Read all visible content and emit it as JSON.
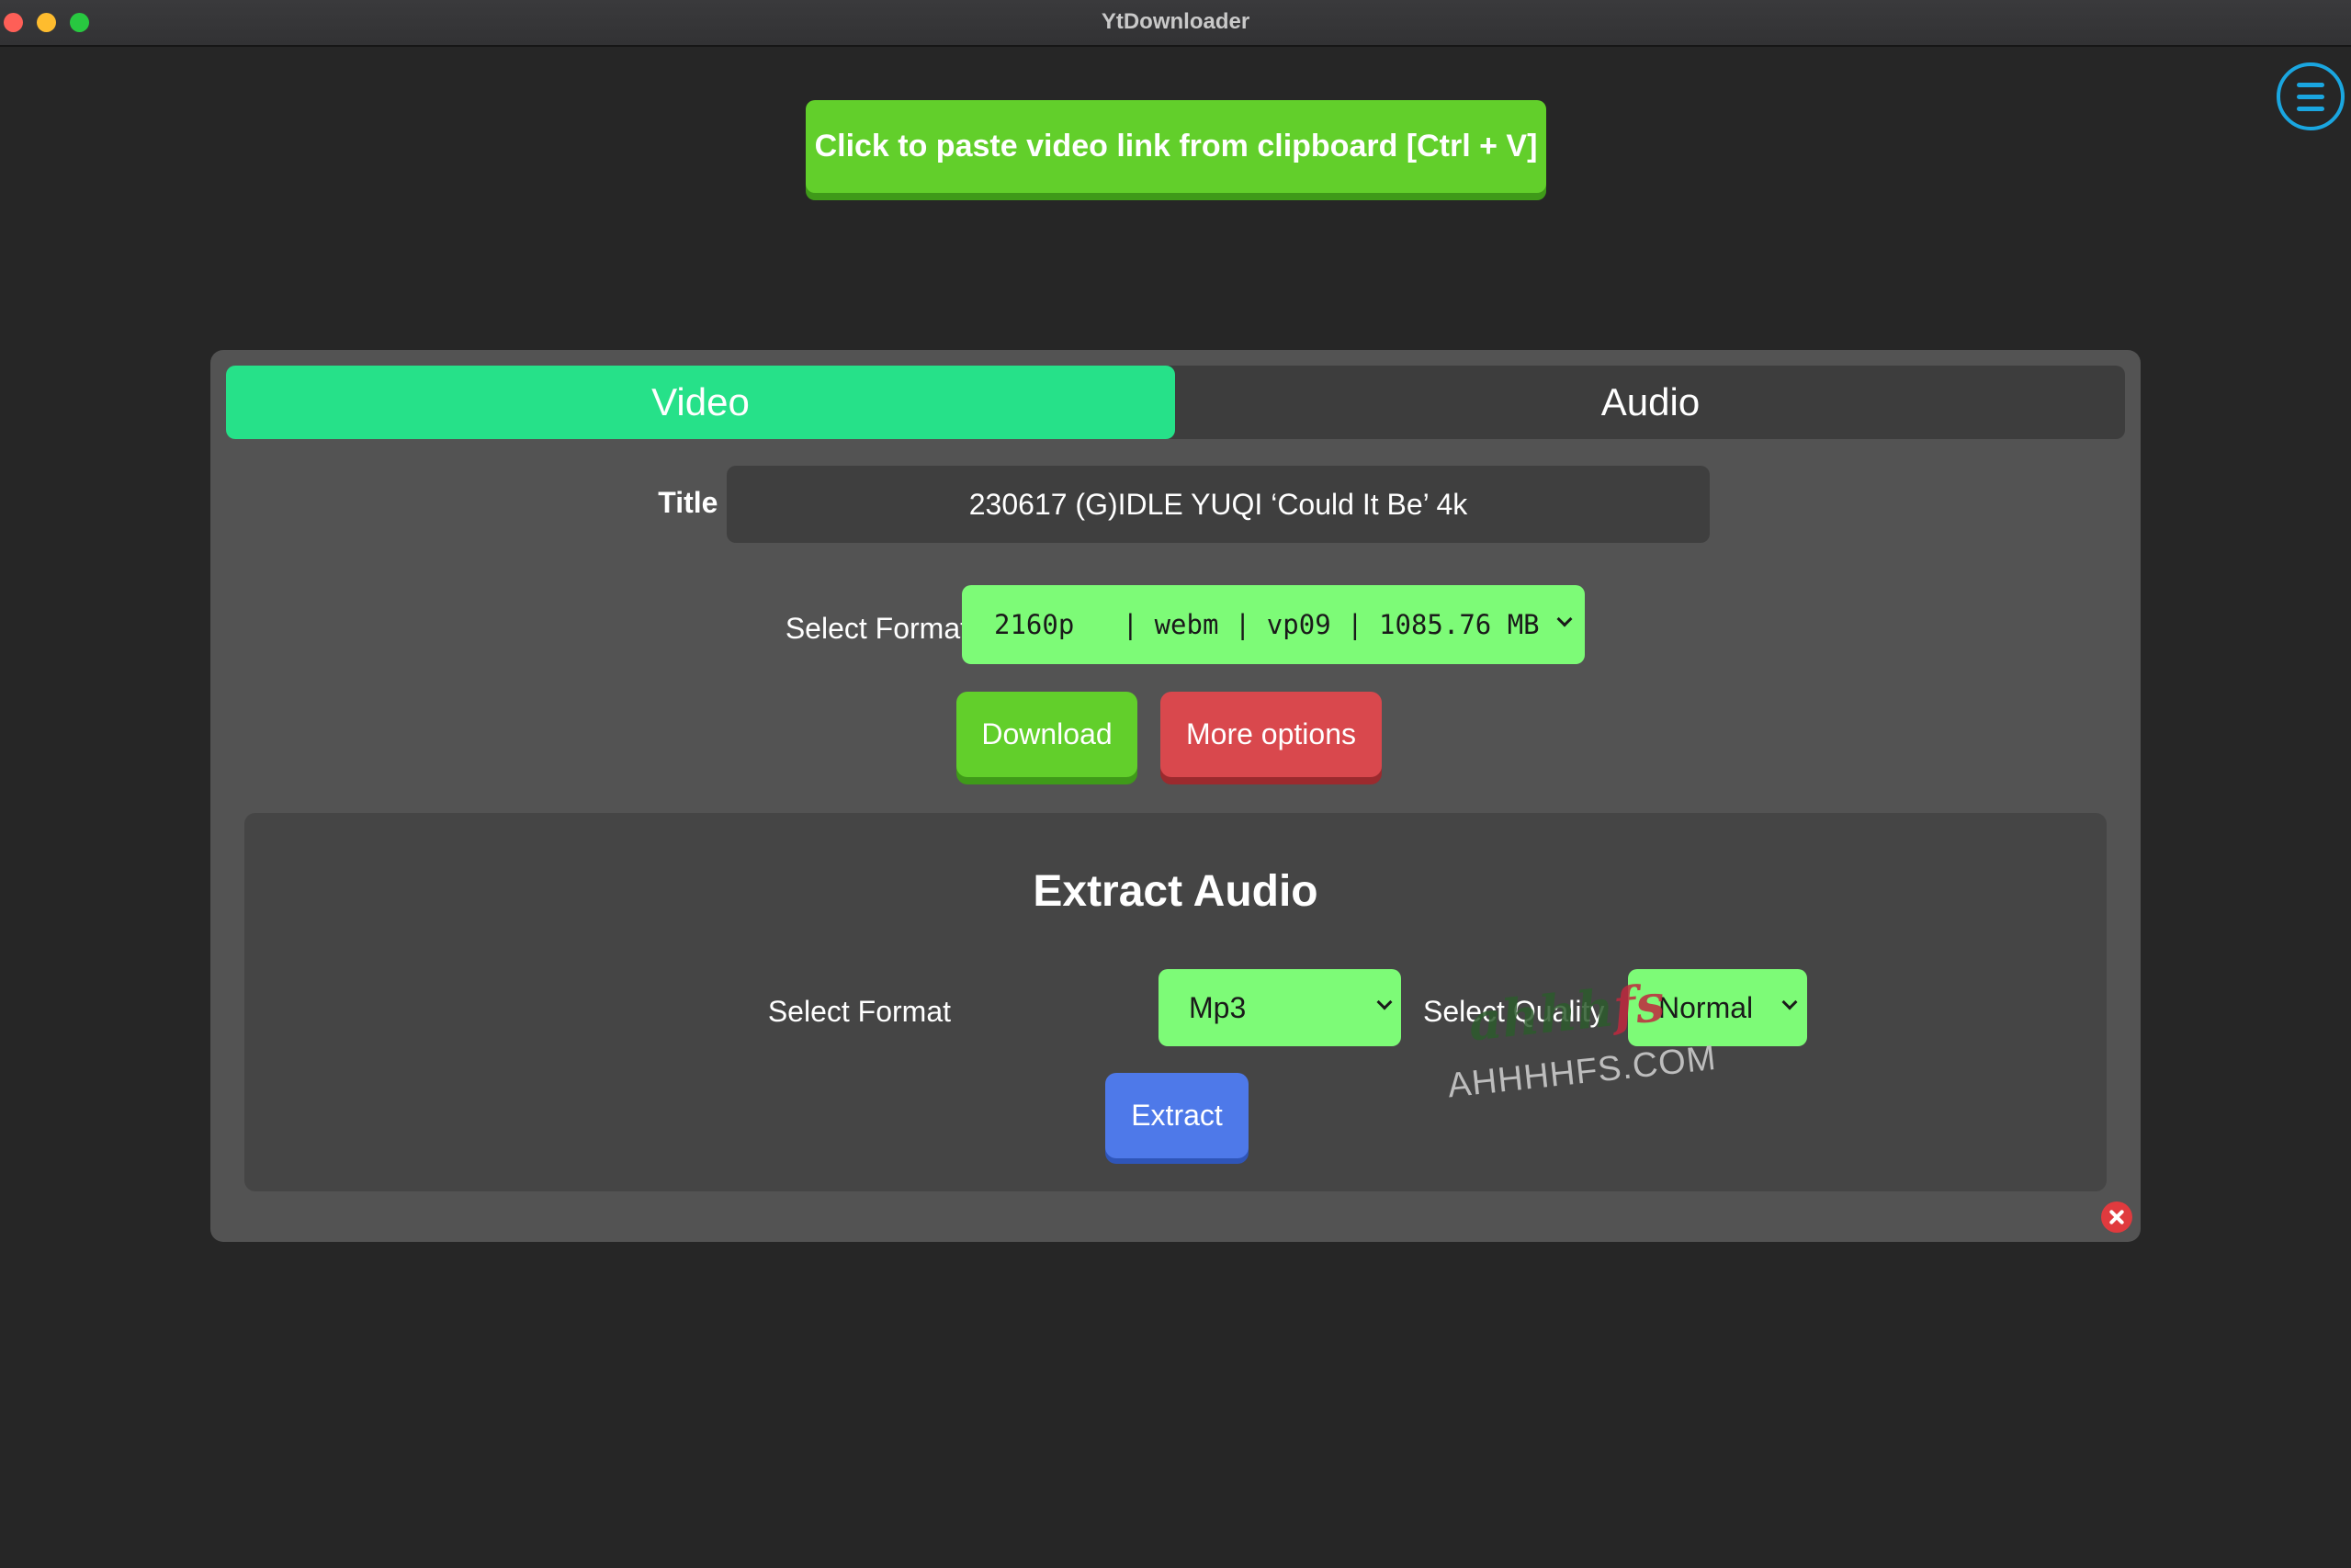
{
  "window": {
    "title": "YtDownloader"
  },
  "header": {
    "paste_label": "Click to paste video link from clipboard [Ctrl + V]",
    "menu_icon": "hamburger-menu-icon"
  },
  "tabs": [
    {
      "label": "Video",
      "active": true
    },
    {
      "label": "Audio",
      "active": false
    }
  ],
  "video": {
    "title_label": "Title :",
    "title_value": "230617 (G)IDLE YUQI ‘Could It Be’ 4k",
    "format_label": "Select Format",
    "format_value": "2160p   | webm | vp09 | 1085.76 MB",
    "download_label": "Download",
    "more_options_label": "More options"
  },
  "extract_audio": {
    "heading": "Extract Audio",
    "format_label": "Select Format",
    "format_value": "Mp3",
    "quality_label": "Select Quality",
    "quality_value": "Normal",
    "extract_label": "Extract"
  },
  "watermark": {
    "script": "ahhh",
    "script_accent": "fs",
    "site": "AHHHHFS.COM"
  },
  "colors": {
    "background": "#262626",
    "accent_green": "#62cf2b",
    "tab_active": "#26e189",
    "select_green": "#7dfb77",
    "danger_red": "#d9484d",
    "extract_blue": "#4e79e9",
    "menu_blue": "#1aa6e0"
  }
}
